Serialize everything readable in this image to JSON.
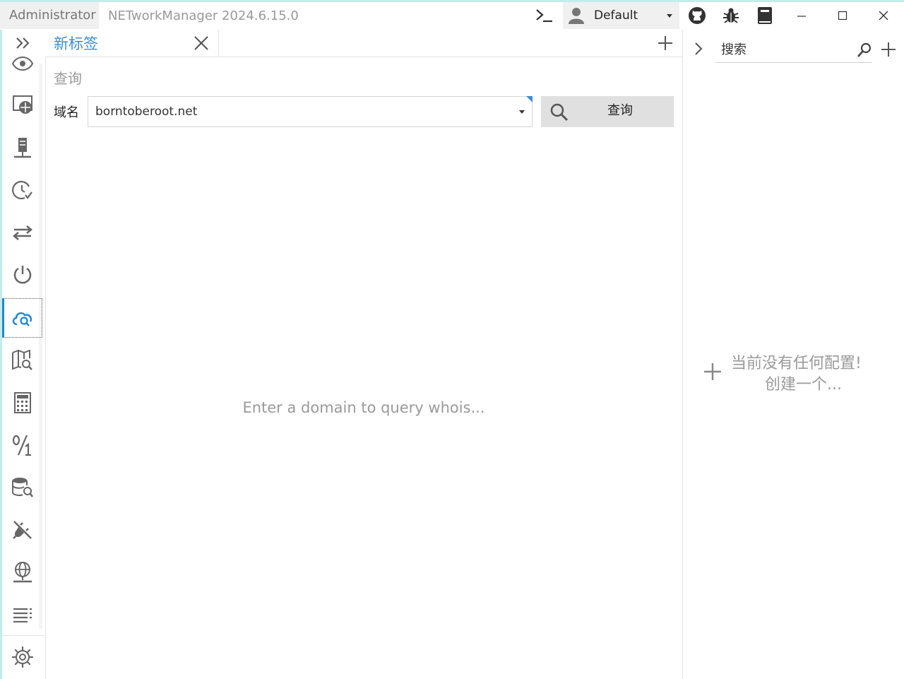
{
  "titlebar": {
    "user_label": "Administrator",
    "app_title": "NETworkManager 2024.6.15.0",
    "profile_name": "Default"
  },
  "sidebar": {
    "active_item": "whois",
    "items": [
      {
        "icon": "eye-icon"
      },
      {
        "icon": "network-interface-icon"
      },
      {
        "icon": "server-icon"
      },
      {
        "icon": "clock-check-icon"
      },
      {
        "icon": "swap-arrows-icon"
      },
      {
        "icon": "power-icon"
      },
      {
        "icon": "cloud-search-icon"
      },
      {
        "icon": "map-search-icon"
      },
      {
        "icon": "calculator-icon"
      },
      {
        "icon": "fraction-icon"
      },
      {
        "icon": "database-search-icon"
      },
      {
        "icon": "plug-off-icon"
      },
      {
        "icon": "globe-network-icon"
      },
      {
        "icon": "list-icon"
      }
    ],
    "settings_icon": "gear-icon"
  },
  "tabs": [
    {
      "label": "新标签"
    }
  ],
  "main": {
    "section_title": "查询",
    "domain_label": "域名",
    "domain_value": "borntoberoot.net",
    "query_button": "查询",
    "empty_message": "Enter a domain to query whois..."
  },
  "profiles_panel": {
    "search_placeholder": "搜索",
    "empty_line1": "当前没有任何配置!",
    "empty_line2": "创建一个..."
  },
  "colors": {
    "accent": "#3b8fd6",
    "top_strip": "#c4ecea",
    "muted_text": "#9a9a9a"
  }
}
